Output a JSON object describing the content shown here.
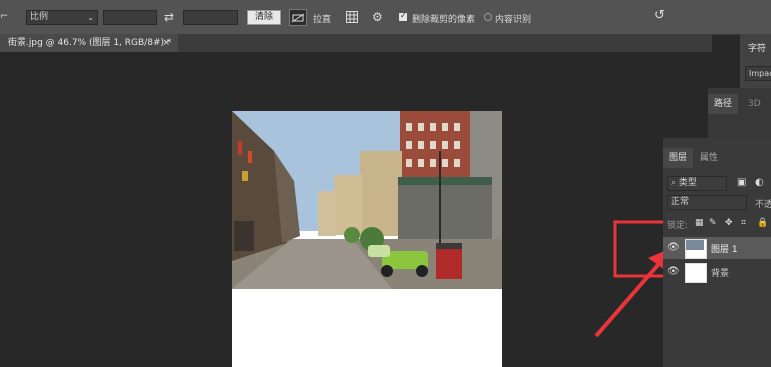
{
  "options_bar": {
    "ratio_value": "比例",
    "width_value": "",
    "height_value": "",
    "clear_label": "清除",
    "straighten_label": "拉直",
    "delete_cropped_label": "删除裁剪的像素",
    "content_aware_label": "内容识别",
    "delete_cropped_checked": true,
    "content_aware_checked": false
  },
  "document_tab": {
    "title": "街景.jpg @ 46.7% (图层 1, RGB/8#) *",
    "close_glyph": "×"
  },
  "character_panel": {
    "tab_label": "字符",
    "font_value": "Impact"
  },
  "paths_panel": {
    "tab_paths": "路径",
    "tab_3d": "3D"
  },
  "layers_panel": {
    "tab_layers": "图层",
    "tab_properties": "属性",
    "filter_label": "类型",
    "blend_mode": "正常",
    "opacity_label": "不透",
    "lock_label": "锁定:",
    "layers": [
      {
        "name": "图层 1",
        "visible": true,
        "selected": true
      },
      {
        "name": "背景",
        "visible": true,
        "selected": false
      }
    ]
  },
  "colors": {
    "highlight_red": "#e8343a",
    "accent_white": "#ffffff"
  }
}
